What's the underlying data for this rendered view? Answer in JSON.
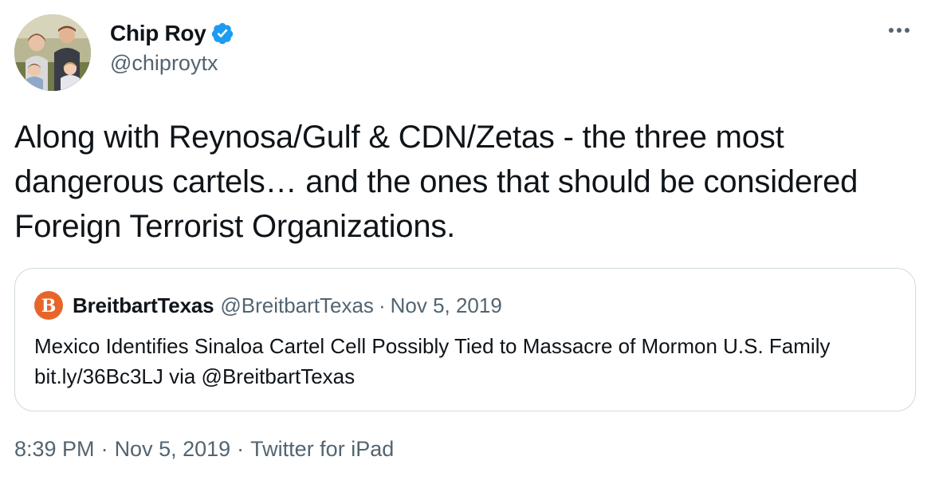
{
  "author": {
    "display_name": "Chip Roy",
    "handle": "@chiproytx",
    "verified": true,
    "avatar_icon": "profile-photo",
    "accent_color": "#1d9bf0"
  },
  "more_icon": "ellipsis-icon",
  "tweet": {
    "text": "Along with Reynosa/Gulf & CDN/Zetas - the three most dangerous cartels… and the ones that should be considered Foreign Terrorist Organizations."
  },
  "quote": {
    "display_name": "BreitbartTexas",
    "handle": "@BreitbartTexas",
    "separator": "·",
    "date": "Nov 5, 2019",
    "avatar_letter": "B",
    "avatar_color": "#e8652a",
    "text": "Mexico Identifies Sinaloa Cartel Cell Possibly Tied to Massacre of Mormon U.S. Family bit.ly/36Bc3LJ via @BreitbartTexas"
  },
  "meta": {
    "time": "8:39 PM",
    "separator": "·",
    "date": "Nov 5, 2019",
    "source": "Twitter for iPad"
  }
}
